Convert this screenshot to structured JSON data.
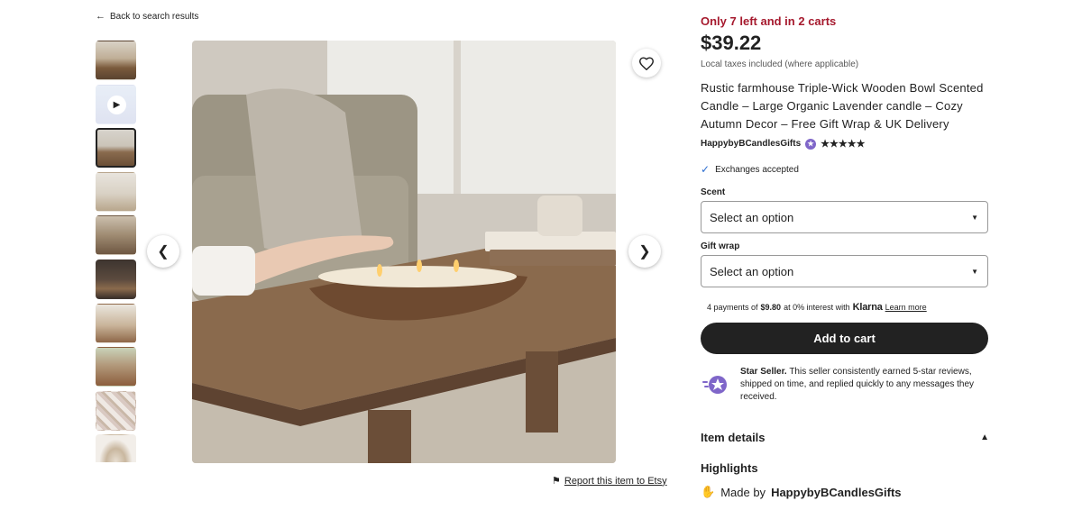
{
  "nav": {
    "back_label": "Back to search results"
  },
  "gallery": {
    "thumbnail_count": 10,
    "selected_index": 2,
    "report_label": "Report this item to Etsy"
  },
  "listing": {
    "stock_text": "Only 7 left and in 2 carts",
    "price": "$39.22",
    "taxes_note": "Local taxes included (where applicable)",
    "title": "Rustic farmhouse Triple-Wick Wooden Bowl Scented Candle – Large Organic Lavender candle – Cozy Autumn Decor – Free Gift Wrap & UK Delivery",
    "shop_name": "HappybyBCandlesGifts",
    "rating_stars": "★★★★★",
    "exchanges": "Exchanges accepted"
  },
  "options": {
    "scent_label": "Scent",
    "scent_value": "Select an option",
    "giftwrap_label": "Gift wrap",
    "giftwrap_value": "Select an option"
  },
  "klarna": {
    "prefix": "4 payments of",
    "amount": "$9.80",
    "middle": "at 0% interest with",
    "brand": "Klarna",
    "learn_more": "Learn more"
  },
  "cart": {
    "add_label": "Add to cart"
  },
  "seller": {
    "badge_title": "Star Seller.",
    "description": "This seller consistently earned 5-star reviews, shipped on time, and replied quickly to any messages they received."
  },
  "details": {
    "item_details_label": "Item details",
    "highlights_label": "Highlights",
    "made_by_prefix": "Made by",
    "made_by_shop": "HappybyBCandlesGifts"
  },
  "colors": {
    "stock_red": "#a61a2e",
    "button_dark": "#222222",
    "star_seller_purple": "#7f66c9"
  }
}
